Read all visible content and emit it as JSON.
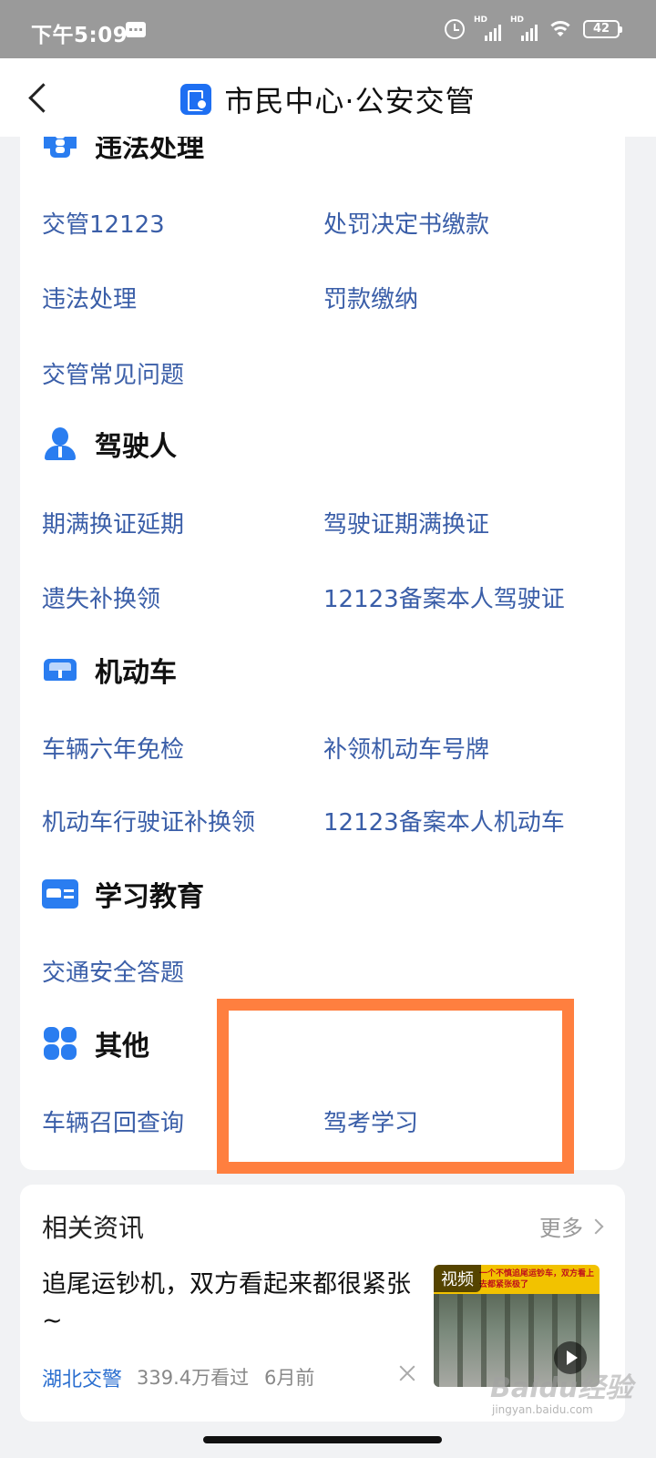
{
  "status_bar": {
    "time": "下午5:09",
    "signal_label": "HD",
    "battery": "42"
  },
  "header": {
    "title": "市民中心·公安交管"
  },
  "sections": [
    {
      "title": "违法处理",
      "icon": "traffic-light-icon",
      "links": [
        "交管12123",
        "处罚决定书缴款",
        "违法处理",
        "罚款缴纳",
        "交管常见问题"
      ]
    },
    {
      "title": "驾驶人",
      "icon": "driver-icon",
      "links": [
        "期满换证延期",
        "驾驶证期满换证",
        "遗失补换领",
        "12123备案本人驾驶证"
      ]
    },
    {
      "title": "机动车",
      "icon": "car-icon",
      "links": [
        "车辆六年免检",
        "补领机动车号牌",
        "机动车行驶证补换领",
        "12123备案本人机动车"
      ]
    },
    {
      "title": "学习教育",
      "icon": "id-card-icon",
      "links": [
        "交通安全答题"
      ]
    },
    {
      "title": "其他",
      "icon": "grid-icon",
      "links": [
        "车辆召回查询",
        "驾考学习"
      ]
    }
  ],
  "news": {
    "title": "相关资讯",
    "more": "更多",
    "headline": "追尾运钞机，双方看起来都很紧张~",
    "source": "湖北交警",
    "views": "339.4万看过",
    "time_ago": "6月前",
    "thumb_tag": "视频",
    "thumb_caption": "一个不慎追尾运钞车，双方看上去都紧张极了"
  },
  "watermark": {
    "logo": "Baidu经验",
    "url": "jingyan.baidu.com"
  },
  "colors": {
    "accent": "#2a7df0",
    "link": "#3a5ea8",
    "highlight": "#ff7f3f"
  }
}
